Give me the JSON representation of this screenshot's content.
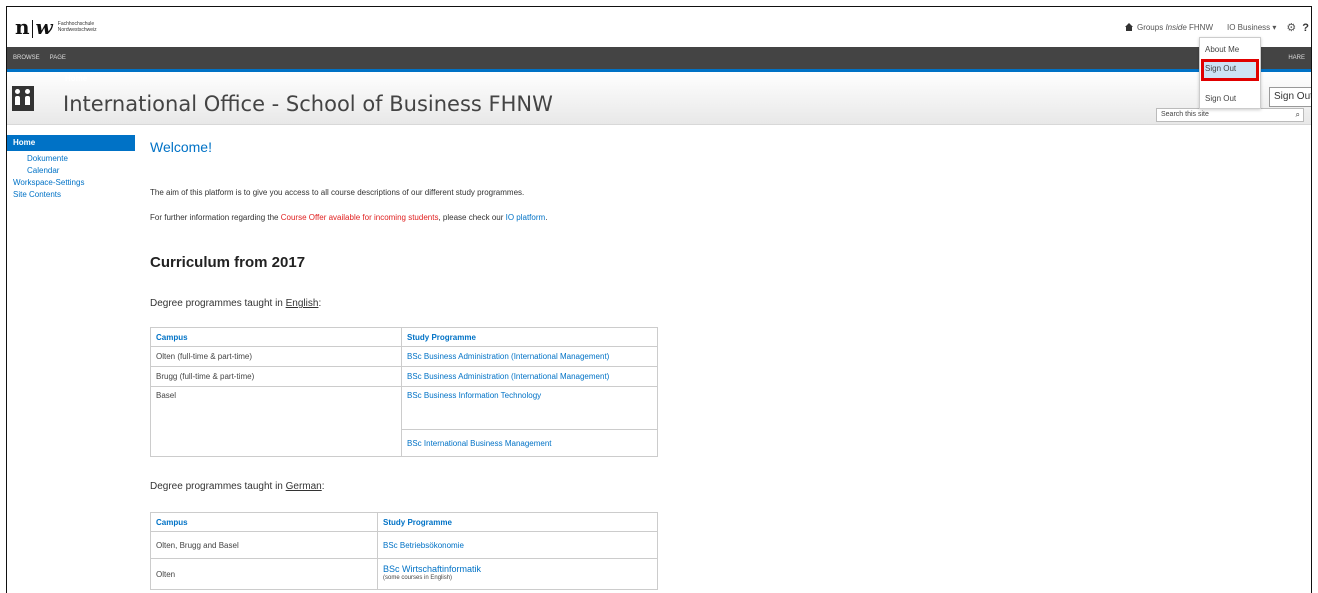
{
  "logo": {
    "mark_n": "n",
    "mark_w": "w",
    "line1": "Fachhochschule",
    "line2": "Nordwestschweiz"
  },
  "suitebar": {
    "groups_prefix": "Groups ",
    "groups_italic": "Inside",
    "groups_suffix": " FHNW",
    "user_menu": "IO Business ▾",
    "gear": "⚙",
    "help": "?"
  },
  "ribbon": {
    "tabs": [
      "BROWSE",
      "PAGE"
    ],
    "share_label": "HARE"
  },
  "breadcrumb": "Home",
  "site_title": "International Office - School of Business FHNW",
  "search": {
    "placeholder": "Search this site",
    "icon": "⌕"
  },
  "user_dropdown": {
    "items": [
      "About Me",
      "Sign Out",
      "Sign Out"
    ],
    "tooltip": "Sign Out"
  },
  "leftnav": {
    "home": "Home",
    "items": [
      {
        "label": "Dokumente",
        "level": 2
      },
      {
        "label": "Calendar",
        "level": 2
      },
      {
        "label": "Workspace-Settings",
        "level": 1
      },
      {
        "label": "Site Contents",
        "level": 1
      }
    ]
  },
  "main": {
    "welcome": "Welcome!",
    "intro": "The aim of this platform is to give you access to all course descriptions of our different study programmes.",
    "further_prefix": "For further information regarding the ",
    "further_link1": "Course Offer available for incoming students",
    "further_mid": ", please check our ",
    "further_link2": "IO platform",
    "further_end": ".",
    "curriculum_heading": "Curriculum from 2017",
    "english_prefix": "Degree programmes taught in ",
    "english_word": "English",
    "english_suffix": ":",
    "german_prefix": "Degree programmes taught in ",
    "german_word": "German",
    "german_suffix": ":",
    "table_headers": {
      "campus": "Campus",
      "programme": "Study Programme"
    },
    "english_rows": [
      {
        "campus": "Olten (full-time & part-time)",
        "programme": "BSc Business Administration (International Management)"
      },
      {
        "campus": "Brugg (full-time & part-time)",
        "programme": "BSc Business Administration (International Management)"
      },
      {
        "campus": "Basel",
        "programme": "BSc Business Information Technology"
      },
      {
        "campus": "",
        "programme": "BSc International Business Management"
      }
    ],
    "german_rows": [
      {
        "campus": "Olten, Brugg and Basel",
        "programme": "BSc Betriebsökonomie",
        "note": ""
      },
      {
        "campus": "Olten",
        "programme": "BSc Wirtschaftinformatik",
        "note": "(some courses in English)"
      }
    ]
  },
  "colors": {
    "accent": "#0072c6",
    "highlight": "#e00000",
    "ribbon": "#444444"
  }
}
